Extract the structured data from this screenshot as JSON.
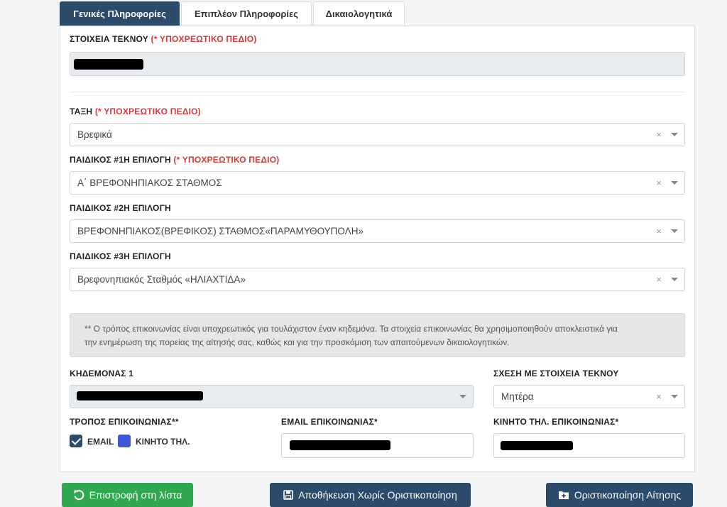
{
  "tabs": [
    {
      "label": "Γενικές Πληροφορίες",
      "active": true
    },
    {
      "label": "Επιπλέον Πληροφορίες",
      "active": false
    },
    {
      "label": "Δικαιολογητικά",
      "active": false
    }
  ],
  "required_text": "(* ΥΠΟΧΡΕΩΤΙΚΟ ΠΕΔΙΟ)",
  "child": {
    "label": "ΣΤΟΙΧΕΙΑ ΤΕΚΝΟΥ",
    "value": ""
  },
  "class_field": {
    "label": "ΤΑΞΗ",
    "value": "Βρεφικά"
  },
  "choice1": {
    "label": "ΠΑΙΔΙΚΟΣ #1Η ΕΠΙΛΟΓΗ",
    "value": "Α΄ ΒΡΕΦΟΝΗΠΙΑΚΟΣ ΣΤΑΘΜΟΣ"
  },
  "choice2": {
    "label": "ΠΑΙΔΙΚΟΣ #2Η ΕΠΙΛΟΓΗ",
    "value": "ΒΡΕΦΟΝΗΠΙΑΚΟΣ(ΒΡΕΦΙΚΟΣ) ΣΤΑΘΜΟΣ«ΠΑΡΑΜΥΘΟΥΠΟΛΗ»"
  },
  "choice3": {
    "label": "ΠΑΙΔΙΚΟΣ #3Η ΕΠΙΛΟΓΗ",
    "value": "Βρεφονηπιακός Σταθμός «ΗΛΙΑΧΤΙΔΑ»"
  },
  "clear_glyph": "×",
  "notice": {
    "line1": "** Ο τρόπος επικοινωνίας είναι υποχρεωτικός για τουλάχιστον έναν κηδεμόνα. Τα στοιχεία επικοινωνίας θα χρησιμοποιηθούν αποκλειστικά για",
    "line2": "την ενημέρωση της πορείας της αίτησής σας, καθώς και για την προσκόμιση των απαιτούμενων δικαιολογητικών."
  },
  "guardian": {
    "label": "ΚΗΔΕΜΟΝΑΣ 1",
    "value": ""
  },
  "relation": {
    "label": "ΣΧΕΣΗ ΜΕ ΣΤΟΙΧΕΙΑ ΤΕΚΝΟΥ",
    "value": "Μητέρα"
  },
  "contact_method": {
    "label": "ΤΡΟΠΟΣ ΕΠΙΚΟΙΝΩΝΙΑΣ**",
    "email_label": "EMAIL",
    "email_checked": true,
    "mobile_label": "ΚΙΝΗΤΟ ΤΗΛ."
  },
  "email": {
    "label": "EMAIL ΕΠΙΚΟΙΝΩΝΙΑΣ*",
    "value": ""
  },
  "mobile": {
    "label": "ΚΙΝΗΤΟ ΤΗΛ. ΕΠΙΚΟΙΝΩΝΙΑΣ*",
    "value": ""
  },
  "buttons": {
    "back": "Επιστροφή στη λίστα",
    "save": "Αποθήκευση Χωρίς Οριστικοποίηση",
    "finalize": "Οριστικοποίηση Αίτησης"
  },
  "colors": {
    "primary": "#2c4a6a",
    "success": "#2fa84f",
    "required": "#d43a3a"
  },
  "icons": {
    "back": "undo-icon",
    "save": "floppy-disk-icon",
    "finalize": "folder-plus-icon"
  }
}
